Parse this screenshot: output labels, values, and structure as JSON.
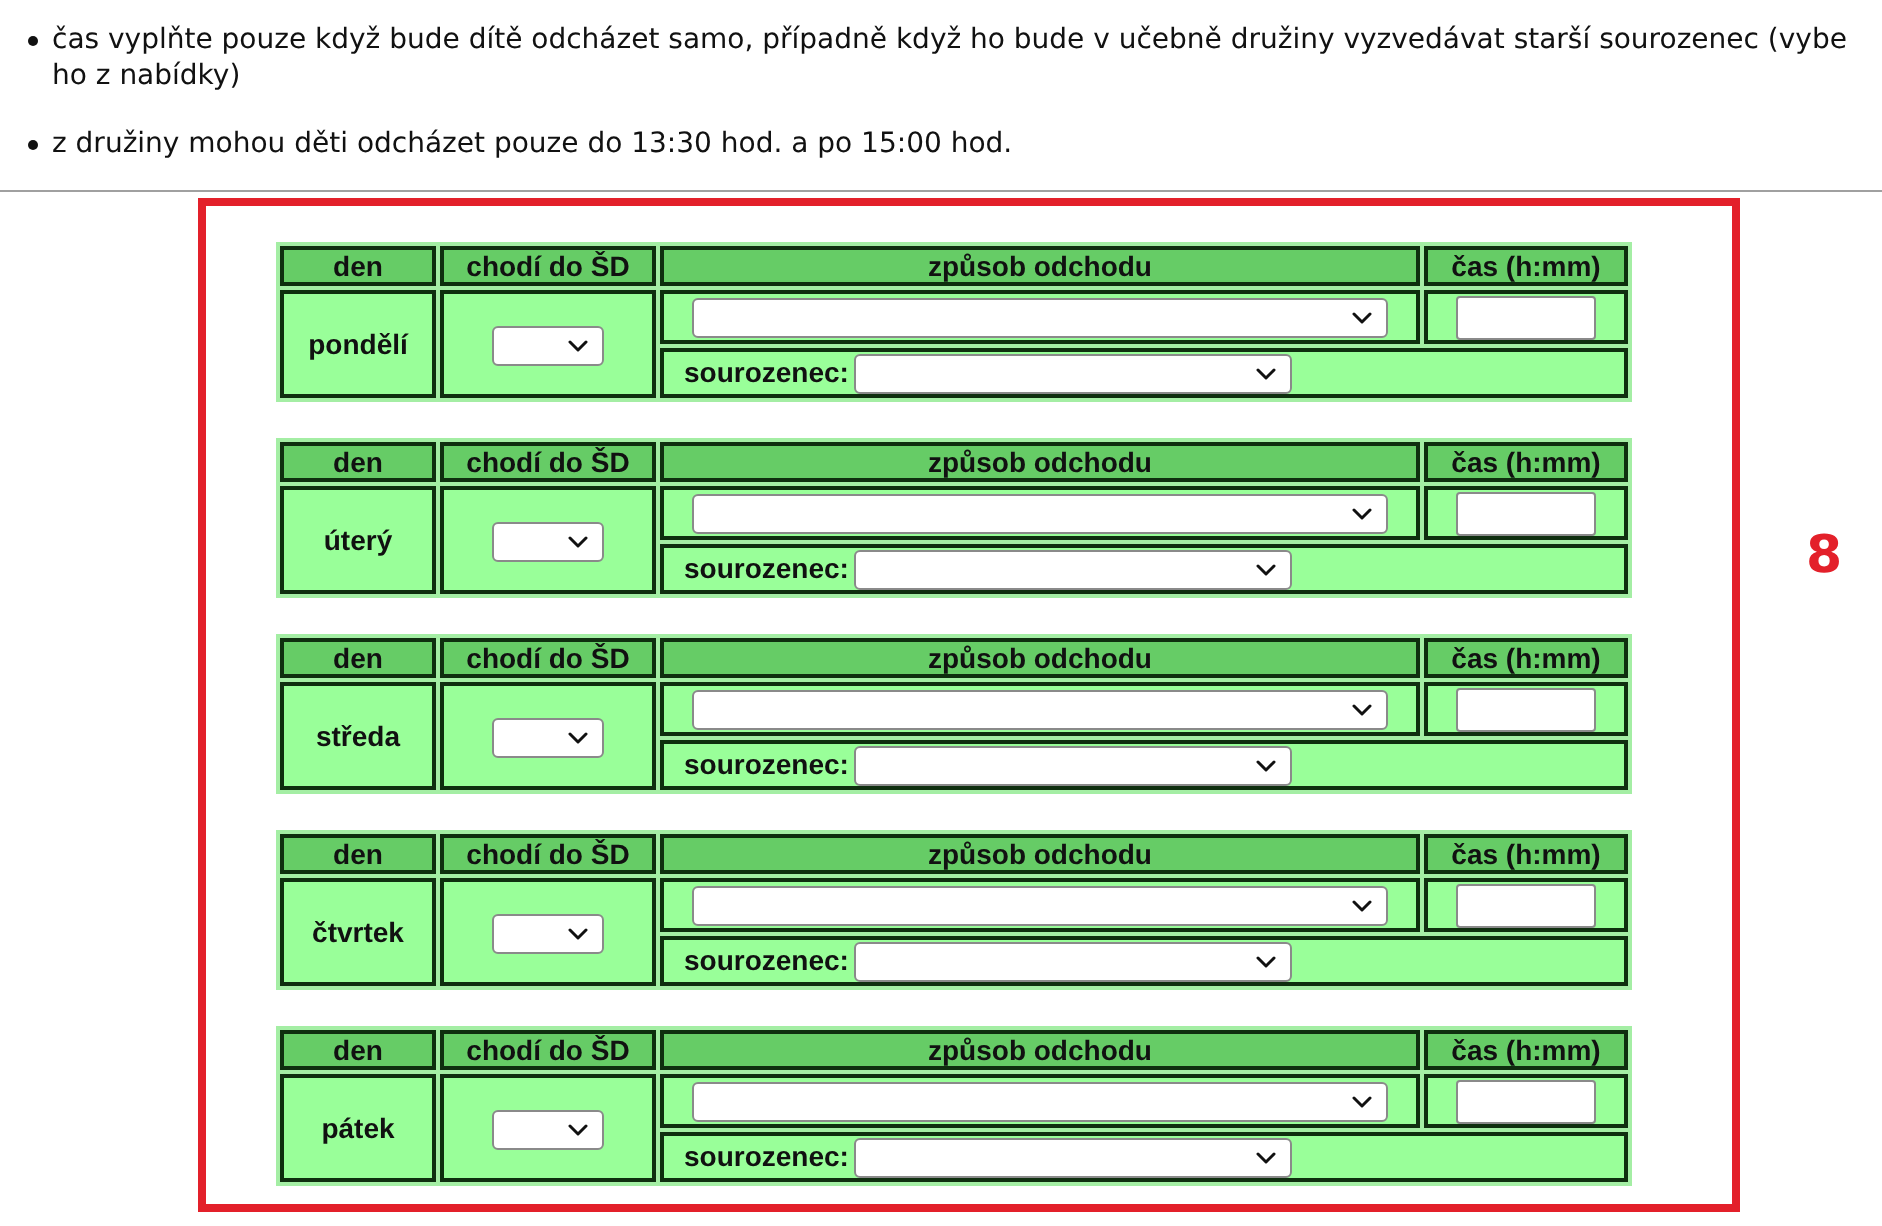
{
  "instructions": [
    {
      "lines": [
        "čas vyplňte pouze když bude dítě odcházet samo, případně když ho bude v učebně družiny vyzvedávat starší sourozenec (vybe",
        "ho z nabídky)"
      ]
    },
    {
      "lines": [
        "z družiny mohou děti odcházet pouze do 13:30 hod. a po 15:00 hod."
      ]
    }
  ],
  "days": [
    {
      "columns": [
        "den",
        "chodí do ŠD",
        "způsob odchodu",
        "čas (h:mm)"
      ],
      "day": "pondělí",
      "sibling_label": "sourozenec:"
    },
    {
      "columns": [
        "den",
        "chodí do ŠD",
        "způsob odchodu",
        "čas (h:mm)"
      ],
      "day": "úterý",
      "sibling_label": "sourozenec:"
    },
    {
      "columns": [
        "den",
        "chodí do ŠD",
        "způsob odchodu",
        "čas (h:mm)"
      ],
      "day": "středa",
      "sibling_label": "sourozenec:"
    },
    {
      "columns": [
        "den",
        "chodí do ŠD",
        "způsob odchodu",
        "čas (h:mm)"
      ],
      "day": "čtvrtek",
      "sibling_label": "sourozenec:"
    },
    {
      "columns": [
        "den",
        "chodí do ŠD",
        "způsob odchodu",
        "čas (h:mm)"
      ],
      "day": "pátek",
      "sibling_label": "sourozenec:"
    }
  ],
  "annotation": {
    "label": "8"
  }
}
